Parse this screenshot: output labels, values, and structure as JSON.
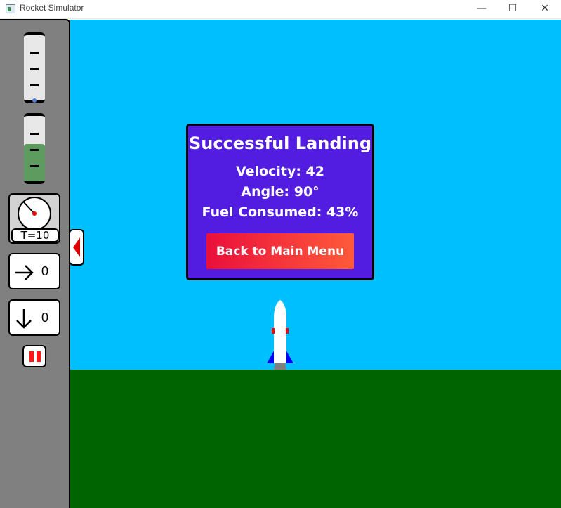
{
  "window": {
    "title": "Rocket Simulator",
    "controls": {
      "minimize": "—",
      "maximize": "☐",
      "close": "✕"
    }
  },
  "colors": {
    "sky": "#00bfff",
    "ground": "#006400",
    "sidebar": "#808080",
    "dialog_bg": "#521de0",
    "button_gradient_start": "#ea0f3b",
    "button_gradient_end": "#ff5a3a",
    "fuel_fill": "#5e9b5e",
    "rocket_fin": "#0000ff",
    "rocket_band": "#ff0000"
  },
  "sidebar": {
    "velocity_gauge": {
      "icon": "vertical-gauge",
      "level": 0.0
    },
    "fuel_gauge": {
      "icon": "vertical-gauge",
      "level": 0.57
    },
    "clock": {
      "icon": "clock-icon",
      "label": "T=10"
    },
    "horizontal_speed": {
      "icon": "arrow-right-icon",
      "value": "0"
    },
    "vertical_speed": {
      "icon": "arrow-down-icon",
      "value": "0"
    },
    "pause": {
      "icon": "pause-icon"
    },
    "collapse": {
      "icon": "chevron-left-icon"
    }
  },
  "dialog": {
    "title": "Successful Landing",
    "velocity": "Velocity: 42",
    "angle": "Angle: 90°",
    "fuel": "Fuel Consumed: 43%",
    "button_label": "Back to Main Menu"
  }
}
